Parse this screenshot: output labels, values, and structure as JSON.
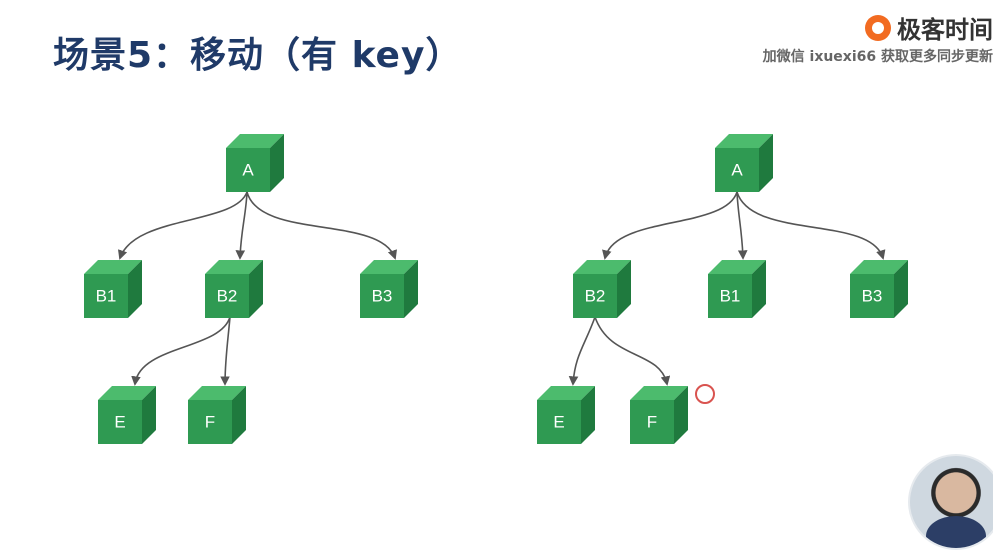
{
  "slide": {
    "title": "场景5：移动（有 key）"
  },
  "brand": {
    "name": "极客时间",
    "logo_icon": "geektime-logo-icon",
    "watermark": "加微信 ixuexi66 获取更多同步更新",
    "accent": "#f26b21"
  },
  "colors": {
    "node_front": "#2f9a52",
    "node_top": "#4cbb6d",
    "node_side": "#1f7a3e",
    "edge": "#555555",
    "marker": "#d9534f"
  },
  "trees": [
    {
      "nodes": {
        "A": "A",
        "B1": "B1",
        "B2": "B2",
        "B3": "B3",
        "E": "E",
        "F": "F"
      }
    },
    {
      "nodes": {
        "A": "A",
        "B2": "B2",
        "B1": "B1",
        "B3": "B3",
        "E": "E",
        "F": "F"
      }
    }
  ]
}
